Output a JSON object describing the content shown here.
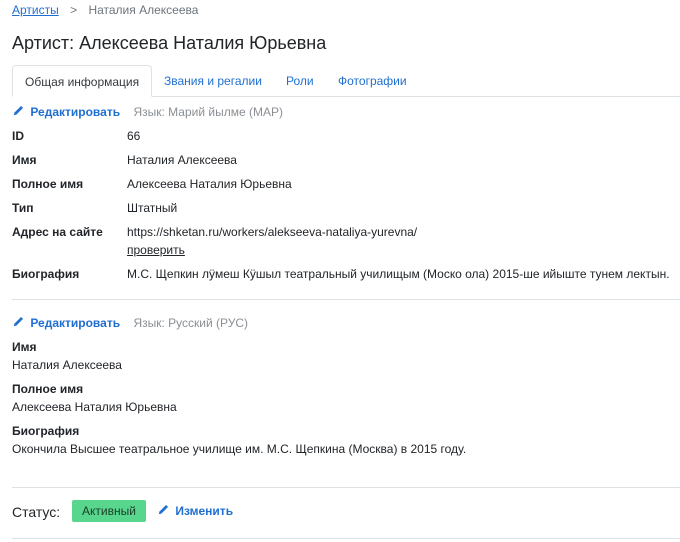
{
  "breadcrumb": {
    "root": "Артисты",
    "separator": ">",
    "current": "Наталия Алексеева"
  },
  "title": "Артист: Алексеева Наталия Юрьевна",
  "tabs": [
    "Общая информация",
    "Звания и регалии",
    "Роли",
    "Фотографии"
  ],
  "section_mari": {
    "edit_label": "Редактировать",
    "language": "Язык: Марий йылме (МАР)",
    "fields": {
      "id_label": "ID",
      "id_value": "66",
      "name_label": "Имя",
      "name_value": "Наталия Алексеева",
      "fullname_label": "Полное имя",
      "fullname_value": "Алексеева Наталия Юрьевна",
      "type_label": "Тип",
      "type_value": "Штатный",
      "url_label": "Адрес на сайте",
      "url_value": "https://shketan.ru/workers/alekseeva-nataliya-yurevna/",
      "check_label": "проверить",
      "bio_label": "Биография",
      "bio_value": "М.С. Щепкин лӱмеш Кӱшыл театральный училищым (Москo ола) 2015-ше ийыште тунем лектын."
    }
  },
  "section_russian": {
    "edit_label": "Редактировать",
    "language": "Язык: Русский (РУС)",
    "name_label": "Имя",
    "name_value": "Наталия Алексеева",
    "fullname_label": "Полное имя",
    "fullname_value": "Алексеева Наталия Юрьевна",
    "bio_label": "Биография",
    "bio_value": "Окончила Высшее театральное училище им. М.С. Щепкина (Москва) в 2015 году."
  },
  "status": {
    "label": "Статус:",
    "badge": "Активный",
    "change_label": "Изменить"
  },
  "colors": {
    "link": "#1f6fd1",
    "badge_bg": "#58d68d"
  },
  "icons": {
    "edit": "pencil-icon"
  }
}
